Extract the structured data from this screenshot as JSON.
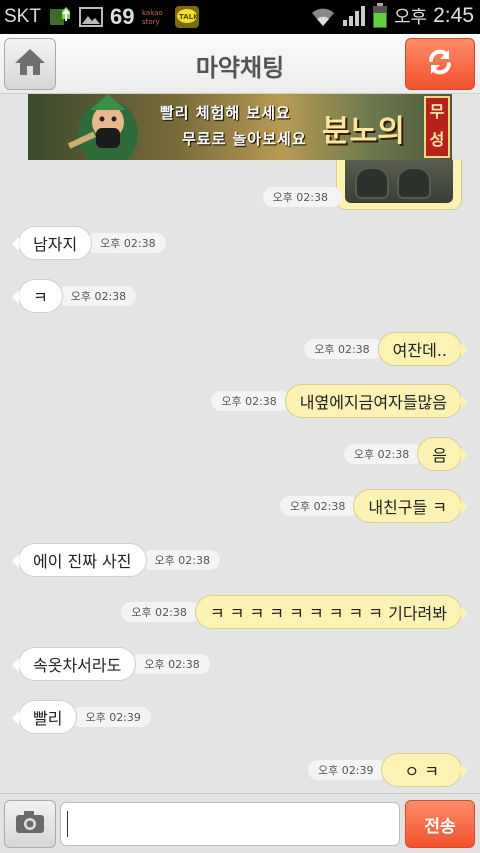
{
  "status_bar": {
    "carrier": "SKT",
    "battery_text": "69",
    "ampm": "오후",
    "time": "2:45",
    "icons": [
      "upload-icon",
      "gallery-icon",
      "kakaostory-icon",
      "kakaotalk-icon",
      "wifi-icon",
      "signal-icon",
      "battery-icon"
    ],
    "kakaostory_label": "kakao story",
    "kakaotalk_label": "TALK"
  },
  "header": {
    "title": "마약채팅",
    "home_icon": "home-icon",
    "refresh_icon": "refresh-icon"
  },
  "ad": {
    "line1": "빨리 체험해 보세요",
    "line2": "무료로 놀아보세요",
    "brand": "분노의",
    "seal": "무성"
  },
  "messages": [
    {
      "side": "out",
      "text": "",
      "time": "오후 02:38",
      "image": true
    },
    {
      "side": "in",
      "text": "남자지",
      "time": "오후 02:38"
    },
    {
      "side": "in",
      "text": "ㅋ",
      "time": "오후 02:38"
    },
    {
      "side": "out",
      "text": "여잔데..",
      "time": "오후 02:38"
    },
    {
      "side": "out",
      "text": "내옆에지금여자들많음",
      "time": "오후 02:38"
    },
    {
      "side": "out",
      "text": "음",
      "time": "오후 02:38"
    },
    {
      "side": "out",
      "text": "내친구들 ㅋ",
      "time": "오후 02:38"
    },
    {
      "side": "in",
      "text": "에이 진짜 사진",
      "time": "오후 02:38"
    },
    {
      "side": "out",
      "text": "ㅋ ㅋ ㅋ ㅋ ㅋ ㅋ ㅋ ㅋ ㅋ 기다려봐",
      "time": "오후 02:38"
    },
    {
      "side": "in",
      "text": "속옷차서라도",
      "time": "오후 02:38"
    },
    {
      "side": "in",
      "text": "빨리",
      "time": "오후 02:39"
    },
    {
      "side": "out",
      "text": "ㅇ ㅋ",
      "time": "오후 02:39"
    }
  ],
  "input_bar": {
    "camera_icon": "camera-icon",
    "input_value": "",
    "send_label": "전송"
  },
  "colors": {
    "accent": "#f4562f",
    "outgoing_bubble": "#fbf2b4",
    "incoming_bubble": "#ffffff",
    "chat_background": "#e4e4e4"
  }
}
